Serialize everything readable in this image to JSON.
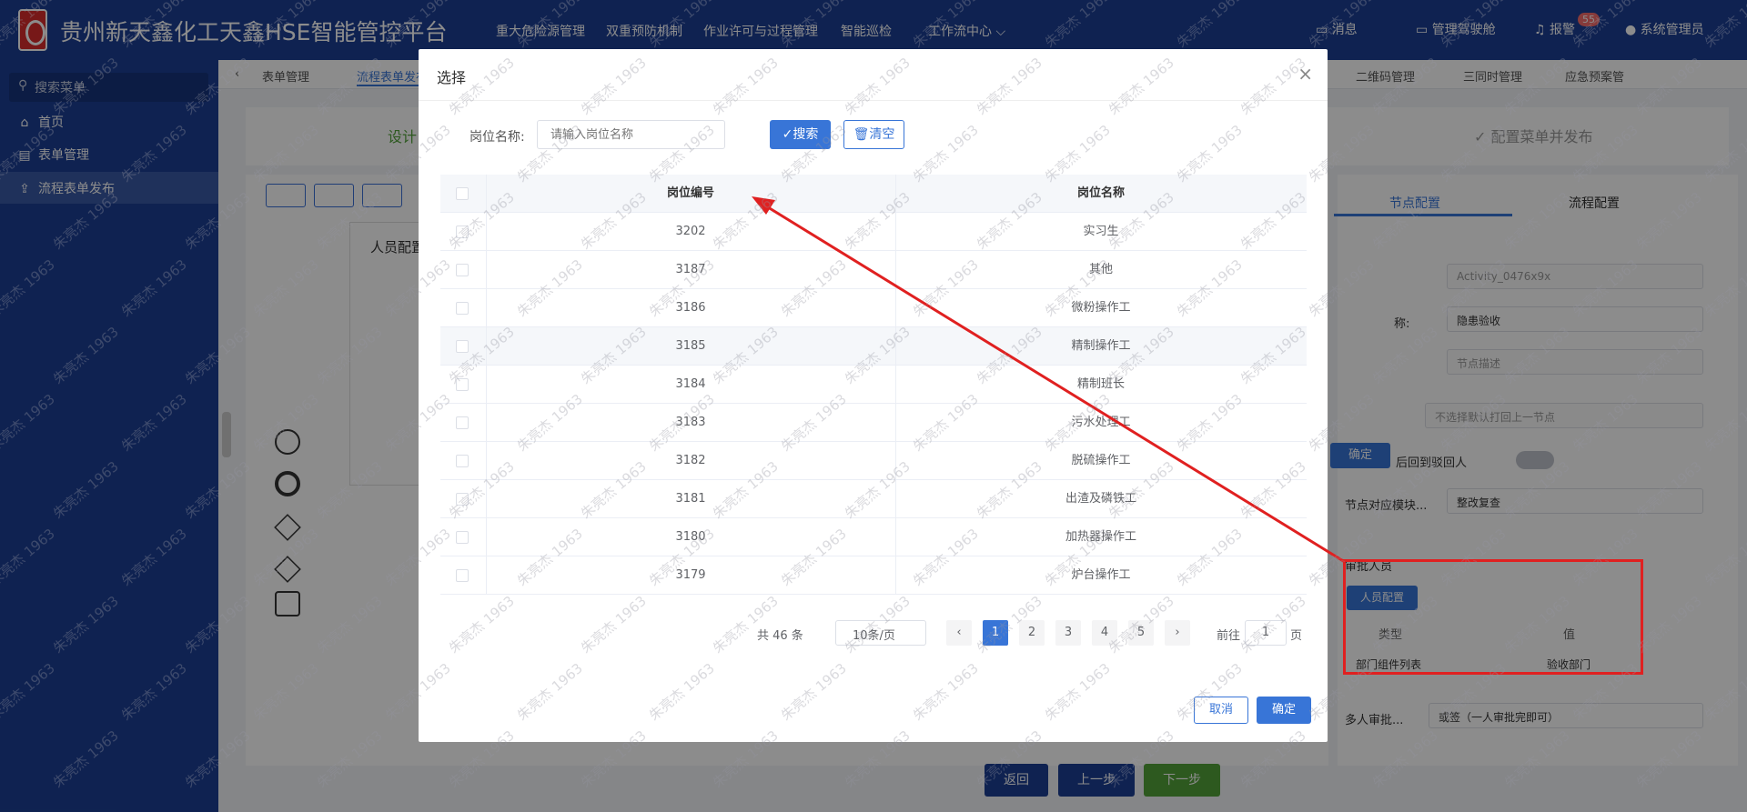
{
  "header": {
    "app_title": "贵州新天鑫化工天鑫HSE智能管控平台",
    "nav": [
      "重大危险源管理",
      "双重预防机制",
      "作业许可与过程管理",
      "智能巡检",
      "工作流中心"
    ],
    "messages_label": "消息",
    "cockpit_label": "管理驾驶舱",
    "alarm_label": "报警",
    "alarm_count": "55",
    "user_label": "系统管理员"
  },
  "sidebar": {
    "search_placeholder": "搜索菜单",
    "items": [
      {
        "label": "首页",
        "icon": "home-icon"
      },
      {
        "label": "表单管理",
        "icon": "document-icon"
      },
      {
        "label": "流程表单发布",
        "icon": "publish-icon"
      }
    ]
  },
  "tabs": [
    "表单管理",
    "流程表单发布",
    "二维码管理",
    "三同时管理",
    "应急预案管"
  ],
  "steps": {
    "design": "设计",
    "publish": "配置菜单并发布"
  },
  "background_panels": {
    "personnel_title": "人员配置",
    "right_tabs": [
      "节点配置",
      "流程配置"
    ],
    "field_values": [
      "Activity_0476x9x",
      "隐患验收",
      "节点描述",
      "不选择默认打回上一节点"
    ],
    "labels": [
      "称:",
      "后回到驳回人",
      "节点对应模块...",
      "审批人员"
    ],
    "module_value": "整改复查",
    "confirm_label": "确定",
    "personnel_btn": "人员配置",
    "table_headers": [
      "类型",
      "值"
    ],
    "table_row": [
      "部门组件列表",
      "验收部门"
    ],
    "multi_label": "多人审批...",
    "multi_value": "或签（一人审批完即可）",
    "bottom_buttons": [
      "返回",
      "上一步",
      "下一步"
    ]
  },
  "dialog": {
    "title": "选择",
    "filter_label": "岗位名称:",
    "filter_placeholder": "请输入岗位名称",
    "search_label": "搜索",
    "clear_label": "清空",
    "columns": [
      "岗位编号",
      "岗位名称"
    ],
    "rows": [
      [
        "3202",
        "实习生"
      ],
      [
        "3187",
        "其他"
      ],
      [
        "3186",
        "微粉操作工"
      ],
      [
        "3185",
        "精制操作工"
      ],
      [
        "3184",
        "精制班长"
      ],
      [
        "3183",
        "污水处理工"
      ],
      [
        "3182",
        "脱硫操作工"
      ],
      [
        "3181",
        "出渣及磷铁工"
      ],
      [
        "3180",
        "加热器操作工"
      ],
      [
        "3179",
        "炉台操作工"
      ]
    ],
    "pagination": {
      "total": "共 46 条",
      "page_size": "10条/页",
      "pages": [
        "1",
        "2",
        "3",
        "4",
        "5"
      ],
      "current": "1",
      "goto_label": "前往",
      "goto_value": "1",
      "page_suffix": "页"
    },
    "cancel_label": "取消",
    "ok_label": "确定"
  },
  "watermark": "朱亮杰 1963",
  "colors": {
    "brand": "#1c3f94",
    "primary": "#3875d7",
    "annotation": "#e02020",
    "next_button": "#52a23a"
  }
}
